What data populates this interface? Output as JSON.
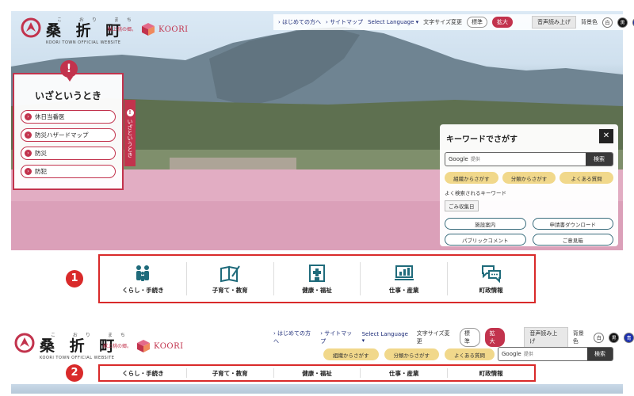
{
  "site": {
    "logo_ruby": "こ おり まち",
    "logo_name": "桑 折 町",
    "logo_sub": "KOORI TOWN OFFICIAL WEBSITE",
    "brand_small": "献上桃の郷。",
    "brand_koori": "KOORI"
  },
  "utility": {
    "first_time": "はじめての方へ",
    "sitemap": "サイトマップ",
    "language": "Select Language ▾",
    "font_size_label": "文字サイズ変更",
    "font_standard": "標準",
    "font_large": "拡大",
    "read_aloud": "音声読み上げ",
    "bg_color_label": "背景色",
    "bg_white": "白",
    "bg_black": "黒",
    "bg_blue": "青"
  },
  "emergency": {
    "alert_glyph": "!",
    "title": "いざというとき",
    "tab_label": "いざというとき",
    "items": [
      {
        "label": "休日当番医"
      },
      {
        "label": "防災ハザードマップ"
      },
      {
        "label": "防災"
      },
      {
        "label": "防犯"
      }
    ]
  },
  "keyword_panel": {
    "title": "キーワードでさがす",
    "close": "✕",
    "google": "Google",
    "placeholder": "提供",
    "search_button": "検索",
    "pills": [
      "組織からさがす",
      "分類からさがす",
      "よくある質問"
    ],
    "often_label": "よく検索されるキーワード",
    "often_tag": "ごみ収集日",
    "links": [
      "施設案内",
      "申請書ダウンロード",
      "パブリックコメント",
      "ご意見箱"
    ]
  },
  "categories": [
    {
      "label": "くらし・手続き",
      "icon": "family-icon"
    },
    {
      "label": "子育て・教育",
      "icon": "book-pen-icon"
    },
    {
      "label": "健康・福祉",
      "icon": "hospital-icon"
    },
    {
      "label": "仕事・産業",
      "icon": "chart-monitor-icon"
    },
    {
      "label": "町政情報",
      "icon": "speech-bubbles-icon"
    }
  ],
  "annotations": {
    "one": "1",
    "two": "2"
  },
  "lower": {
    "pills": [
      "組織からさがす",
      "分類からさがす",
      "よくある質問"
    ],
    "google": "Google",
    "placeholder": "提供",
    "search_button": "検索"
  },
  "colors": {
    "accent_red": "#c2334d",
    "annotation_red": "#d92a2a",
    "pill_yellow": "#f1d88b",
    "link_teal": "#3a6d7d"
  }
}
